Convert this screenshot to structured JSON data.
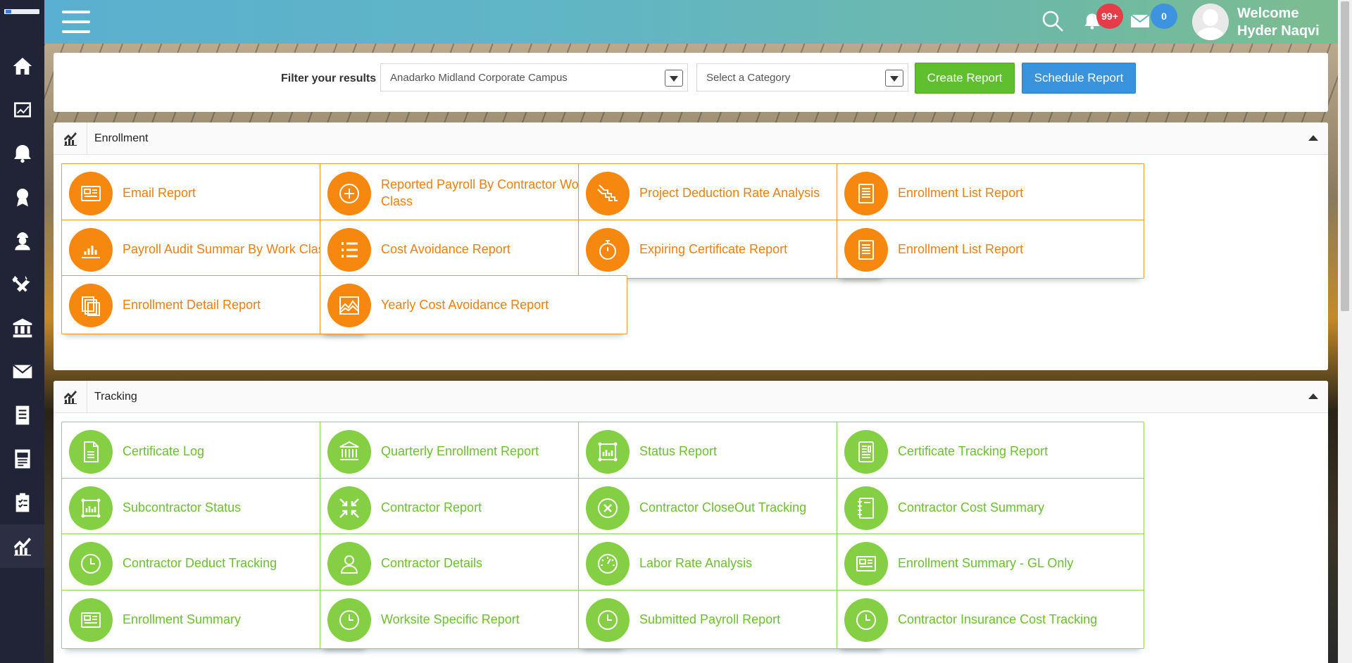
{
  "app": {
    "colors": {
      "accent_orange": "#f7880f",
      "accent_green": "#84cf43",
      "sidebar": "#212437",
      "btn_green": "#5fbf2e",
      "btn_blue": "#3a93dd"
    }
  },
  "sidebar": {
    "logo_icon": "company-logo",
    "items": [
      {
        "icon": "home-icon"
      },
      {
        "icon": "dashboard-chart-icon"
      },
      {
        "icon": "bell-icon"
      },
      {
        "icon": "award-ribbon-icon"
      },
      {
        "icon": "worker-icon"
      },
      {
        "icon": "tools-icon"
      },
      {
        "icon": "bank-icon"
      },
      {
        "icon": "mail-icon"
      },
      {
        "icon": "document-icon"
      },
      {
        "icon": "newspaper-icon"
      },
      {
        "icon": "clipboard-checklist-icon"
      },
      {
        "icon": "analytics-icon",
        "active": true
      }
    ]
  },
  "topbar": {
    "notifications_count": "99+",
    "messages_count": "0",
    "welcome_line1": "Welcome",
    "welcome_line2": "Hyder Naqvi"
  },
  "filter": {
    "label": "Filter your results",
    "location_value": "Anadarko Midland Corporate Campus",
    "category_value": "Select a Category",
    "create_label": "Create Report",
    "schedule_label": "Schedule Report"
  },
  "sections": {
    "enrollment": {
      "title": "Enrollment",
      "cards": [
        {
          "label": "Email Report",
          "icon": "newspaper-icon"
        },
        {
          "label": "Reported Payroll By Contractor Work Class",
          "icon": "plus-circle-icon"
        },
        {
          "label": "Project Deduction Rate Analysis",
          "icon": "stairs-down-icon"
        },
        {
          "label": "Enrollment List Report",
          "icon": "list-document-icon"
        },
        {
          "label": "Payroll Audit Summar By Work Class",
          "icon": "bar-chart-icon"
        },
        {
          "label": "Cost Avoidance Report",
          "icon": "bullet-list-icon"
        },
        {
          "label": "Expiring Certificate Report",
          "icon": "stopwatch-icon"
        },
        {
          "label": "Enrollment List Report",
          "icon": "list-document-icon"
        },
        {
          "label": "Enrollment Detail Report",
          "icon": "copy-pages-icon"
        },
        {
          "label": "Yearly Cost Avoidance Report",
          "icon": "area-chart-icon"
        }
      ]
    },
    "tracking": {
      "title": "Tracking",
      "cards": [
        {
          "label": "Certificate Log",
          "icon": "file-icon"
        },
        {
          "label": "Quarterly Enrollment Report",
          "icon": "bank-icon"
        },
        {
          "label": "Status Report",
          "icon": "chart-box-icon"
        },
        {
          "label": "Certificate Tracking Report",
          "icon": "id-card-icon"
        },
        {
          "label": "Subcontractor Status",
          "icon": "chart-box-icon"
        },
        {
          "label": "Contractor Report",
          "icon": "compress-arrows-icon"
        },
        {
          "label": "Contractor CloseOut Tracking",
          "icon": "close-circle-icon"
        },
        {
          "label": "Contractor Cost Summary",
          "icon": "notebook-icon"
        },
        {
          "label": "Contractor Deduct Tracking",
          "icon": "clock-icon"
        },
        {
          "label": "Contractor Details",
          "icon": "user-icon"
        },
        {
          "label": "Labor Rate Analysis",
          "icon": "gauge-icon"
        },
        {
          "label": "Enrollment Summary - GL Only",
          "icon": "newspaper-icon"
        },
        {
          "label": "Enrollment Summary",
          "icon": "newspaper-icon"
        },
        {
          "label": "Worksite Specific Report",
          "icon": "clock-icon"
        },
        {
          "label": "Submitted Payroll Report",
          "icon": "clock-icon"
        },
        {
          "label": "Contractor Insurance Cost Tracking",
          "icon": "clock-icon"
        }
      ]
    }
  }
}
